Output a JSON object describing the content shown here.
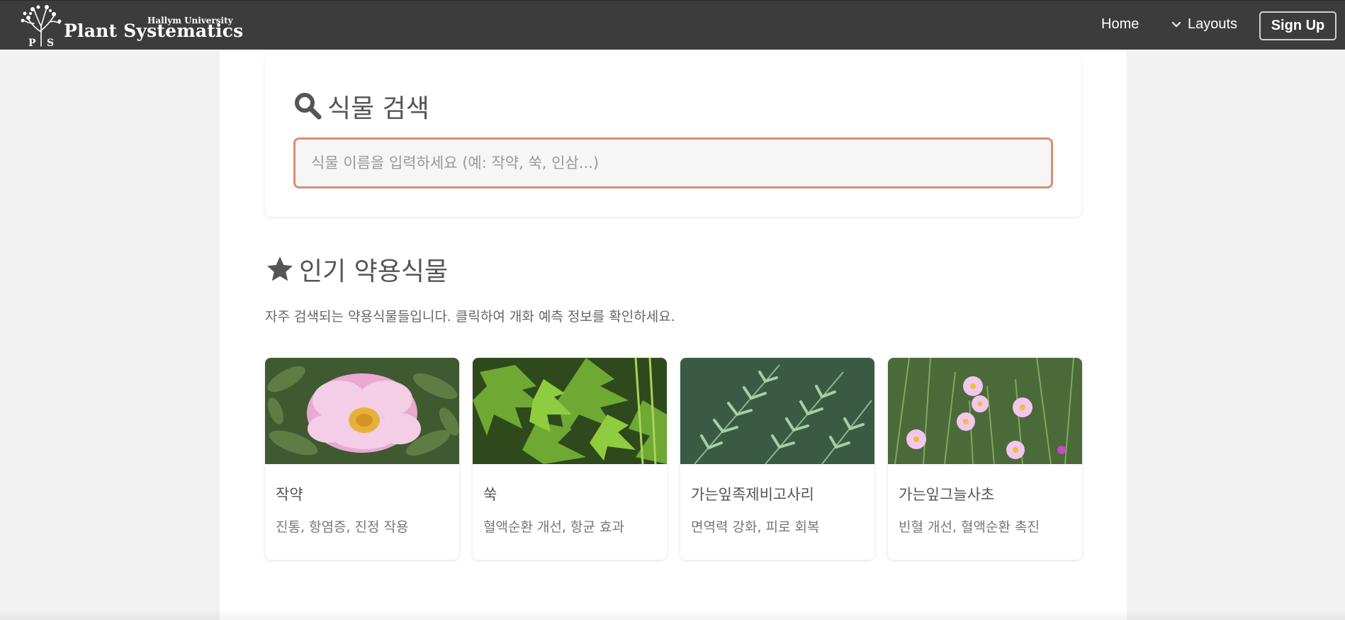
{
  "navbar": {
    "brand_university": "Hallym University",
    "brand_name": "Plant Systematics",
    "home_label": "Home",
    "layouts_label": "Layouts",
    "signup_label": "Sign Up"
  },
  "search": {
    "title": "식물 검색",
    "placeholder": "식물 이름을 입력하세요 (예: 작약, 쑥, 인삼...)",
    "value": ""
  },
  "popular": {
    "title": "인기 약용식물",
    "description": "자주 검색되는 약용식물들입니다. 클릭하여 개화 예측 정보를 확인하세요.",
    "plants": [
      {
        "name": "작약",
        "effect": "진통, 항염증, 진정 작용"
      },
      {
        "name": "쑥",
        "effect": "혈액순환 개선, 항균 효과"
      },
      {
        "name": "가는잎족제비고사리",
        "effect": "면역력 강화, 피로 회복"
      },
      {
        "name": "가는잎그늘사초",
        "effect": "빈혈 개선, 혈액순환 촉진"
      }
    ]
  },
  "colors": {
    "navbar_bg": "#3c3c3c",
    "search_border": "#d98e74",
    "text": "#555555"
  }
}
